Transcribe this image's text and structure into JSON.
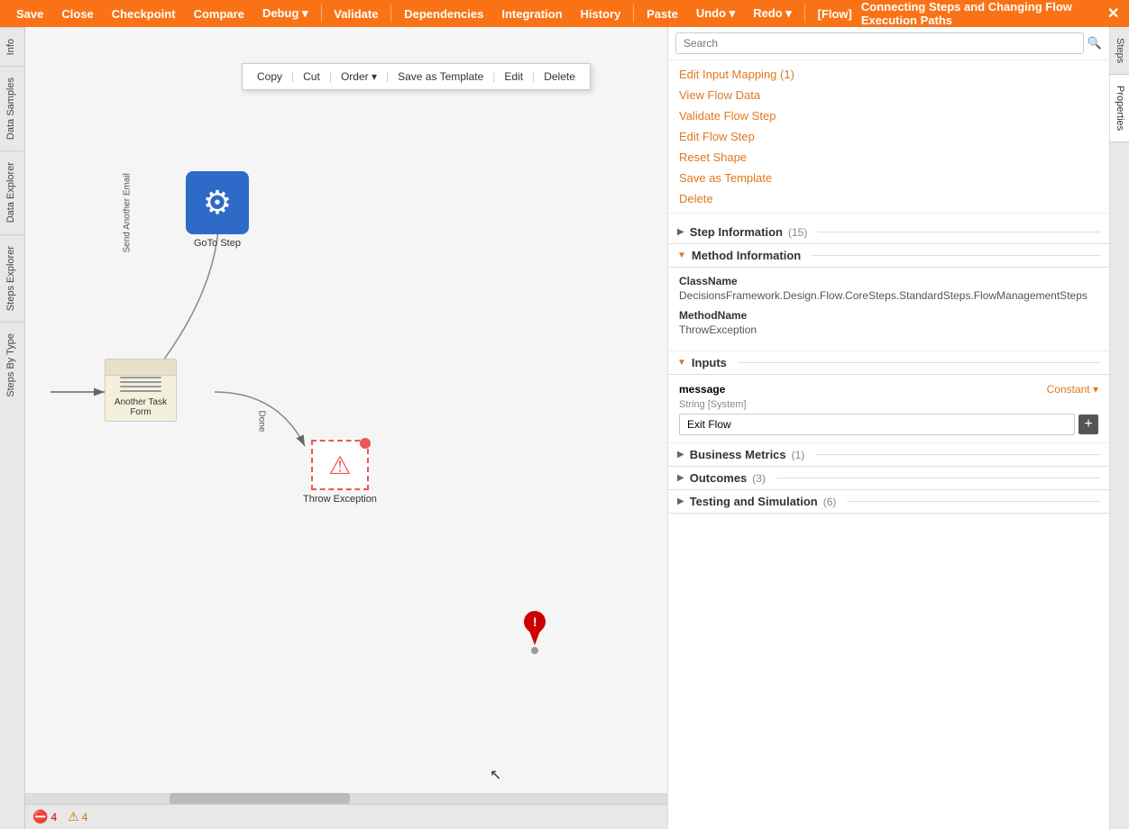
{
  "menubar": {
    "items": [
      {
        "label": "Save",
        "id": "save"
      },
      {
        "label": "Close",
        "id": "close"
      },
      {
        "label": "Checkpoint",
        "id": "checkpoint"
      },
      {
        "label": "Compare",
        "id": "compare"
      },
      {
        "label": "Debug ▾",
        "id": "debug"
      },
      {
        "label": "Validate",
        "id": "validate"
      },
      {
        "label": "Dependencies",
        "id": "dependencies"
      },
      {
        "label": "Integration",
        "id": "integration"
      },
      {
        "label": "History",
        "id": "history"
      },
      {
        "label": "Paste",
        "id": "paste"
      },
      {
        "label": "Undo ▾",
        "id": "undo"
      },
      {
        "label": "Redo ▾",
        "id": "redo"
      },
      {
        "label": "[Flow]",
        "id": "flow"
      },
      {
        "label": "Connecting Steps and Changing Flow Execution Paths",
        "id": "title"
      }
    ],
    "close_label": "✕"
  },
  "context_menu": {
    "items": [
      {
        "label": "Copy",
        "id": "copy"
      },
      {
        "label": "Cut",
        "id": "cut"
      },
      {
        "label": "Order ▾",
        "id": "order"
      },
      {
        "label": "Save as Template",
        "id": "save-template"
      },
      {
        "label": "Edit",
        "id": "edit"
      },
      {
        "label": "Delete",
        "id": "delete"
      }
    ]
  },
  "left_sidebar": {
    "tabs": [
      "Info",
      "Data Samples",
      "Data Explorer",
      "Steps Explorer",
      "Steps By Type"
    ]
  },
  "canvas": {
    "nodes": {
      "goto_step": {
        "label": "GoTo Step"
      },
      "task_form": {
        "label": "Another Task Form"
      },
      "throw_exception": {
        "label": "Throw Exception"
      }
    },
    "connection_labels": {
      "send_another_email": "Send Another Email",
      "done": "Done"
    }
  },
  "right_panel": {
    "search_placeholder": "Search",
    "menu_items": [
      {
        "label": "Edit Input Mapping (1)",
        "id": "edit-input-mapping"
      },
      {
        "label": "View Flow Data",
        "id": "view-flow-data"
      },
      {
        "label": "Validate Flow Step",
        "id": "validate-flow-step"
      },
      {
        "label": "Edit Flow Step",
        "id": "edit-flow-step"
      },
      {
        "label": "Reset Shape",
        "id": "reset-shape"
      },
      {
        "label": "Save as Template",
        "id": "save-as-template"
      },
      {
        "label": "Delete",
        "id": "delete"
      }
    ],
    "sections": {
      "step_information": {
        "label": "Step Information",
        "count": "(15)"
      },
      "method_information": {
        "label": "Method Information",
        "class_name_label": "ClassName",
        "class_name_value": "DecisionsFramework.Design.Flow.CoreSteps.StandardSteps.FlowManagementSteps",
        "method_name_label": "MethodName",
        "method_name_value": "ThrowException"
      },
      "inputs": {
        "label": "Inputs",
        "fields": [
          {
            "name": "message",
            "type": "String [System]",
            "mode": "Constant ▾",
            "value": "Exit Flow"
          }
        ]
      },
      "business_metrics": {
        "label": "Business Metrics",
        "count": "(1)"
      },
      "outcomes": {
        "label": "Outcomes",
        "count": "(3)"
      },
      "testing_simulation": {
        "label": "Testing and Simulation",
        "count": "(6)"
      }
    },
    "tabs": [
      "Steps",
      "Properties"
    ]
  },
  "status_bar": {
    "error_count": "4",
    "warning_count": "4"
  }
}
